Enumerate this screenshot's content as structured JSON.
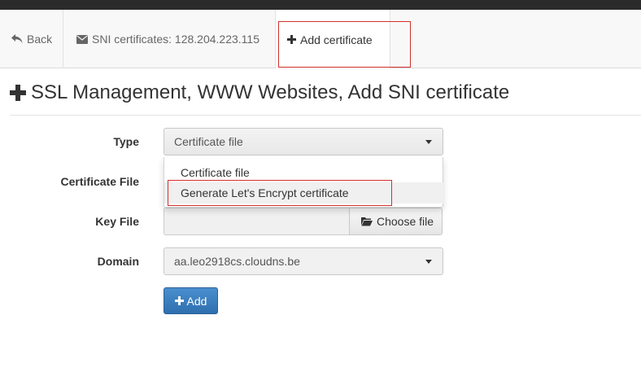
{
  "tabs": {
    "back_label": "Back",
    "sni_label": "SNI certificates: 128.204.223.115",
    "add_label": "Add certificate"
  },
  "page": {
    "title": "SSL Management, WWW Websites, Add SNI certificate"
  },
  "form": {
    "type_label": "Type",
    "type_value": "Certificate file",
    "certificate_file_label": "Certificate File",
    "key_file_label": "Key File",
    "choose_file_label": "Choose file",
    "domain_label": "Domain",
    "domain_value": "aa.leo2918cs.cloudns.be",
    "add_button_label": "Add"
  },
  "type_dropdown": {
    "options": [
      "Certificate file",
      "Generate Let's Encrypt certificate"
    ],
    "hovered_index": 1
  },
  "icons": {
    "back": "reply-icon",
    "sni": "envelope-icon",
    "add": "plus-icon",
    "folder": "folder-open-icon"
  },
  "colors": {
    "primary_button": "#337ab7",
    "highlight_box": "#d0312d",
    "top_bar": "#2b2b2b"
  }
}
